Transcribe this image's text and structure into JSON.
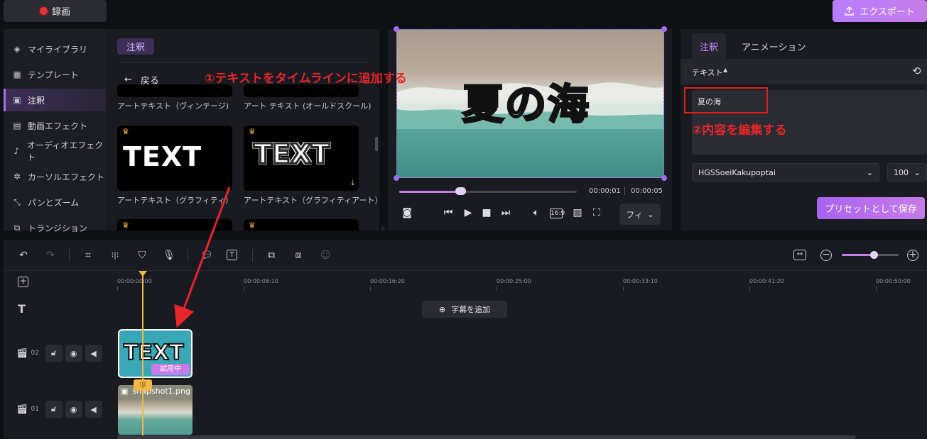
{
  "topbar": {
    "record_label": "録画",
    "export_label": "エクスポート"
  },
  "sidebar": {
    "items": [
      {
        "label": "マイライブラリ",
        "icon": "layers-icon"
      },
      {
        "label": "テンプレート",
        "icon": "template-icon"
      },
      {
        "label": "注釈",
        "icon": "annotation-icon"
      },
      {
        "label": "動画エフェクト",
        "icon": "video-effect-icon"
      },
      {
        "label": "オーディオエフェクト",
        "icon": "audio-effect-icon"
      },
      {
        "label": "カーソルエフェクト",
        "icon": "cursor-effect-icon"
      },
      {
        "label": "パンとズーム",
        "icon": "pan-zoom-icon"
      },
      {
        "label": "トランジション",
        "icon": "transition-icon"
      }
    ],
    "active": "注釈"
  },
  "library": {
    "tag": "注釈",
    "back_label": "戻る",
    "items": [
      {
        "label": "アートテキスト（ヴィンテージ)",
        "art": ""
      },
      {
        "label": "アート テキスト (オールドスクール)",
        "art": ""
      },
      {
        "label": "アートテキスト（グラフィティ）",
        "art": "TEXT"
      },
      {
        "label": "アートテキスト（グラフィティアート）",
        "art": "TEXT"
      }
    ]
  },
  "preview": {
    "overlay_text": "夏の海",
    "time_current": "00:00:01",
    "time_total": "00:00:05",
    "progress": 0.35,
    "fit_label": "フィ"
  },
  "properties": {
    "tab_active": "注釈",
    "tab_other": "アニメーション",
    "section_label": "テキスト",
    "text_value": "夏の海",
    "font": "HGSSoeiKakupoptai",
    "size": "100",
    "preset_button": "プリセットとして保存"
  },
  "annotations": {
    "step1": "①テキストをタイムラインに追加する",
    "step2": "②内容を編集する"
  },
  "timeline": {
    "ruler": [
      "00:00:00:00",
      "00:00:08:10",
      "00:00:16:20",
      "00:00:25:00",
      "00:00:33:10",
      "00:00:41:20",
      "00:00:50:00"
    ],
    "caption_label": "字幕を追加",
    "tracks": [
      {
        "number": "02",
        "clip_label": "TEXT",
        "badge": "試用中"
      },
      {
        "number": "01",
        "clip_label": "snapshot1.png"
      }
    ],
    "split_badge": "⁝|⁝",
    "zoom": 0.62
  },
  "colors": {
    "accent": "#c77be8",
    "annotation_red": "#e6262a",
    "playhead": "#f2b843"
  }
}
